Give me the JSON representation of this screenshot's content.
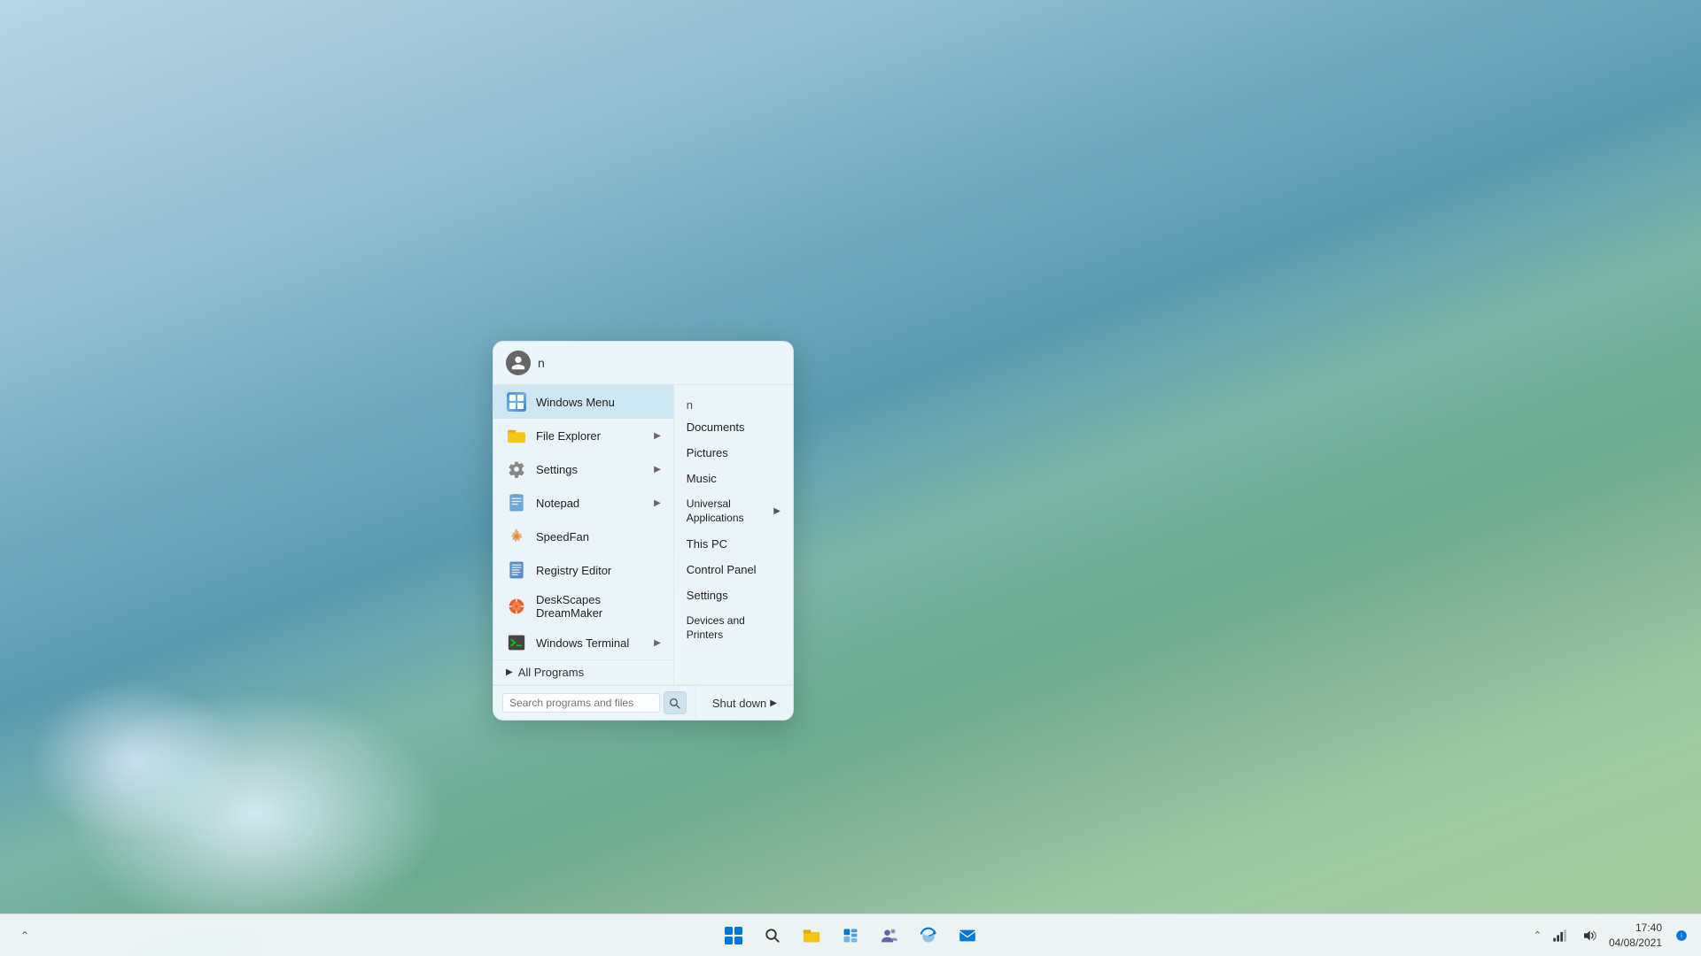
{
  "desktop": {
    "background_desc": "Windows 11 style landscape with mountains, water, and blue sky"
  },
  "start_menu": {
    "search_query": "n",
    "apps": [
      {
        "id": "windows-menu",
        "label": "Windows Menu",
        "icon_type": "windows-grid",
        "has_arrow": false
      },
      {
        "id": "file-explorer",
        "label": "File Explorer",
        "icon_type": "folder",
        "has_arrow": true
      },
      {
        "id": "settings",
        "label": "Settings",
        "icon_type": "gear",
        "has_arrow": true
      },
      {
        "id": "notepad",
        "label": "Notepad",
        "icon_type": "notepad",
        "has_arrow": true
      },
      {
        "id": "speedfan",
        "label": "SpeedFan",
        "icon_type": "fan",
        "has_arrow": false
      },
      {
        "id": "registry-editor",
        "label": "Registry Editor",
        "icon_type": "registry",
        "has_arrow": false
      },
      {
        "id": "deskscapes",
        "label": "DeskScapes DreamMaker",
        "icon_type": "deskscapes",
        "has_arrow": false
      },
      {
        "id": "windows-terminal",
        "label": "Windows Terminal",
        "icon_type": "terminal",
        "has_arrow": true
      }
    ],
    "all_programs_label": "All Programs",
    "places": {
      "n_header": "n",
      "items": [
        {
          "id": "documents",
          "label": "Documents"
        },
        {
          "id": "pictures",
          "label": "Pictures"
        },
        {
          "id": "music",
          "label": "Music"
        },
        {
          "id": "universal-apps",
          "label": "Universal Applications",
          "has_arrow": true
        },
        {
          "id": "this-pc",
          "label": "This PC"
        },
        {
          "id": "control-panel",
          "label": "Control Panel"
        },
        {
          "id": "settings",
          "label": "Settings"
        },
        {
          "id": "devices",
          "label": "Devices and Printers"
        }
      ]
    },
    "search_placeholder": "Search programs and files",
    "shutdown_label": "Shut down"
  },
  "taskbar": {
    "center_icons": [
      {
        "id": "start",
        "icon": "⊞",
        "label": "Start"
      },
      {
        "id": "search",
        "icon": "🔍",
        "label": "Search"
      },
      {
        "id": "file-explorer",
        "icon": "📁",
        "label": "File Explorer"
      },
      {
        "id": "widgets",
        "icon": "⊡",
        "label": "Widgets"
      },
      {
        "id": "teams",
        "icon": "💬",
        "label": "Teams"
      },
      {
        "id": "edge",
        "icon": "🌐",
        "label": "Edge"
      },
      {
        "id": "mail",
        "icon": "✉",
        "label": "Mail"
      }
    ],
    "tray": {
      "time": "17:40",
      "date": "04/08/2021"
    }
  }
}
